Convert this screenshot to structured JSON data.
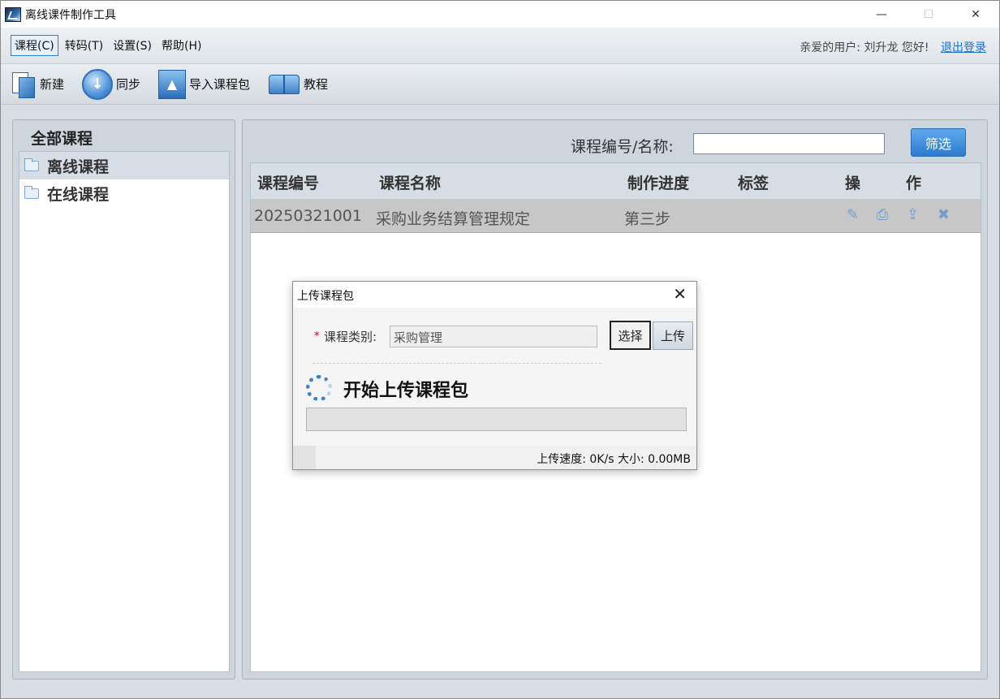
{
  "window": {
    "title": "离线课件制作工具"
  },
  "menu": {
    "items": [
      "课程(C)",
      "转码(T)",
      "设置(S)",
      "帮助(H)"
    ],
    "greeting": "亲爱的用户: 刘升龙 您好!",
    "logout": "退出登录"
  },
  "toolbar": {
    "new": "新建",
    "sync": "同步",
    "import": "导入课程包",
    "tutorial": "教程"
  },
  "sidebar": {
    "title": "全部课程",
    "items": [
      {
        "label": "离线课程",
        "selected": true
      },
      {
        "label": "在线课程",
        "selected": false
      }
    ]
  },
  "filter": {
    "label": "课程编号/名称:",
    "value": "",
    "button": "筛选"
  },
  "table": {
    "headers": [
      "课程编号",
      "课程名称",
      "制作进度",
      "标签",
      "操",
      "作"
    ],
    "rows": [
      {
        "id": "20250321001",
        "name": "采购业务结算管理规定",
        "progress": "第三步",
        "tag": ""
      }
    ],
    "row_actions": [
      "edit-icon",
      "preview-icon",
      "upload-icon",
      "delete-icon"
    ]
  },
  "dialog": {
    "title": "上传课程包",
    "category_label": "课程类别:",
    "category_value": "采购管理",
    "select_button": "选择",
    "upload_button": "上传",
    "status_heading": "开始上传课程包",
    "progress_fraction": 0,
    "status_bar": "上传速度: 0K/s 大小: 0.00MB"
  },
  "colors": {
    "accent": "#2b7bd0",
    "required": "#d40000",
    "link": "#1a6fd0"
  }
}
